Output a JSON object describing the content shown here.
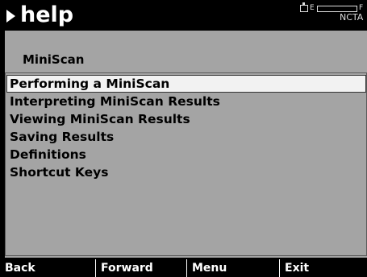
{
  "header": {
    "title": "help",
    "title_icon": "play-arrow-icon",
    "battery": {
      "empty_label": "E",
      "full_label": "F",
      "icon": "battery-icon"
    },
    "mode_label": "NCTA"
  },
  "section": {
    "title": "MiniScan"
  },
  "menu": {
    "items": [
      {
        "label": "Performing a MiniScan",
        "selected": true
      },
      {
        "label": "Interpreting MiniScan Results",
        "selected": false
      },
      {
        "label": "Viewing MiniScan Results",
        "selected": false
      },
      {
        "label": "Saving Results",
        "selected": false
      },
      {
        "label": "Definitions",
        "selected": false
      },
      {
        "label": "Shortcut Keys",
        "selected": false
      }
    ]
  },
  "softkeys": [
    {
      "label": "Back"
    },
    {
      "label": "Forward"
    },
    {
      "label": "Menu"
    },
    {
      "label": "Exit"
    }
  ],
  "colors": {
    "background": "#000000",
    "panel": "#a4a4a4",
    "selection": "#f2f2f2",
    "text_light": "#ffffff"
  }
}
